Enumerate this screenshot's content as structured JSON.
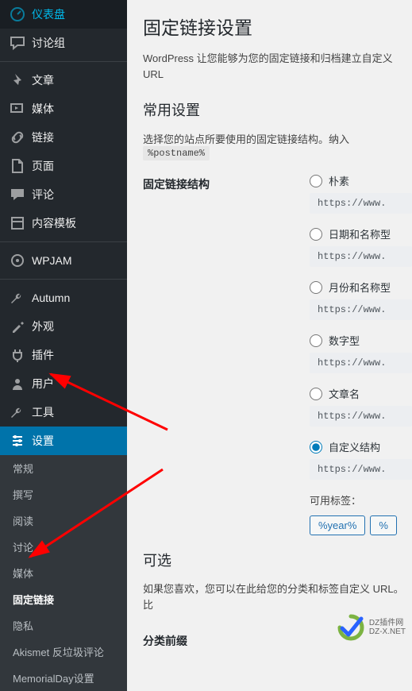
{
  "sidebar": {
    "items": [
      {
        "label": "仪表盘",
        "icon": "gauge"
      },
      {
        "label": "讨论组",
        "icon": "chat"
      },
      {
        "sep": true
      },
      {
        "label": "文章",
        "icon": "pin"
      },
      {
        "label": "媒体",
        "icon": "media"
      },
      {
        "label": "链接",
        "icon": "link"
      },
      {
        "label": "页面",
        "icon": "page"
      },
      {
        "label": "评论",
        "icon": "comment"
      },
      {
        "label": "内容模板",
        "icon": "template"
      },
      {
        "sep": true
      },
      {
        "label": "WPJAM",
        "icon": "wpjam"
      },
      {
        "sep": true
      },
      {
        "label": "Autumn",
        "icon": "wrench"
      },
      {
        "label": "外观",
        "icon": "brush"
      },
      {
        "label": "插件",
        "icon": "plug"
      },
      {
        "label": "用户",
        "icon": "user"
      },
      {
        "label": "工具",
        "icon": "wrench"
      },
      {
        "label": "设置",
        "icon": "sliders",
        "active": true
      }
    ],
    "submenu": [
      {
        "label": "常规"
      },
      {
        "label": "撰写"
      },
      {
        "label": "阅读"
      },
      {
        "label": "讨论"
      },
      {
        "label": "媒体"
      },
      {
        "label": "固定链接",
        "current": true
      },
      {
        "label": "隐私"
      },
      {
        "label": "Akismet 反垃圾评论"
      },
      {
        "label": "MemorialDay设置"
      }
    ]
  },
  "main": {
    "page_title": "固定链接设置",
    "desc": "WordPress 让您能够为您的固定链接和归档建立自定义 URL",
    "section_common": "常用设置",
    "note_prefix": "选择您的站点所要使用的固定链接结构。纳入",
    "note_tag": "%postname%",
    "struct_label": "固定链接结构",
    "options": [
      {
        "label": "朴素",
        "url": "https://www."
      },
      {
        "label": "日期和名称型",
        "url": "https://www."
      },
      {
        "label": "月份和名称型",
        "url": "https://www."
      },
      {
        "label": "数字型",
        "url": "https://www."
      },
      {
        "label": "文章名",
        "url": "https://www."
      },
      {
        "label": "自定义结构",
        "url": "https://www.",
        "checked": true
      }
    ],
    "tags_label": "可用标签：",
    "tag_buttons": [
      "%year%",
      "%"
    ],
    "section_optional": "可选",
    "optional_desc": "如果您喜欢，您可以在此给您的分类和标签自定义 URL。比",
    "cat_prefix_label": "分类前缀"
  },
  "watermark": {
    "brand": "DZ插件网",
    "url": "DZ-X.NET"
  }
}
